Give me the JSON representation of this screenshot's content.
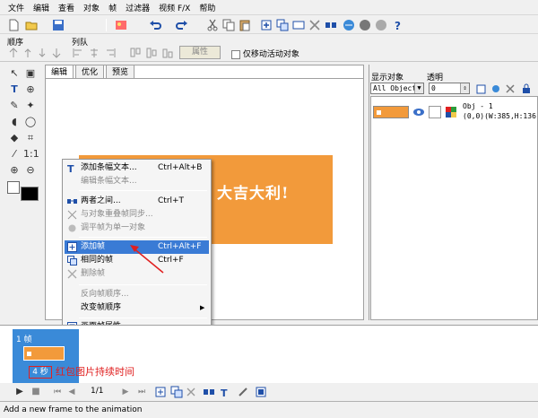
{
  "menu": [
    "文件",
    "编辑",
    "查看",
    "对象",
    "帧",
    "过滤器",
    "视频 F/X",
    "帮助"
  ],
  "toolbar2": {
    "order_label": "顺序",
    "align_label": "列队",
    "props_label": "属性",
    "move_only_label": "仅移动活动对象"
  },
  "tabs": [
    "编辑",
    "优化",
    "预览"
  ],
  "canvas": {
    "banner_text": "计，大吉大利!",
    "banner_color": "#f29a3b"
  },
  "context_menu": {
    "items": [
      {
        "label": "添加条幅文本...",
        "shortcut": "Ctrl+Alt+B",
        "enabled": true,
        "icon": "text-banner-icon"
      },
      {
        "label": "编辑条幅文本...",
        "shortcut": "",
        "enabled": false,
        "icon": ""
      },
      {
        "label": "两者之间...",
        "shortcut": "Ctrl+T",
        "enabled": true,
        "icon": "tween-icon"
      },
      {
        "label": "与对象重叠帧同步...",
        "shortcut": "",
        "enabled": false,
        "icon": "sync-icon"
      },
      {
        "label": "调平帧为单一对象",
        "shortcut": "",
        "enabled": false,
        "icon": "flatten-icon"
      },
      {
        "label": "添加帧",
        "shortcut": "Ctrl+Alt+F",
        "enabled": true,
        "highlighted": true,
        "icon": "add-frame-icon"
      },
      {
        "label": "相同的帧",
        "shortcut": "Ctrl+F",
        "enabled": true,
        "icon": "duplicate-frame-icon"
      },
      {
        "label": "删除帧",
        "shortcut": "",
        "enabled": false,
        "icon": "delete-frame-icon"
      },
      {
        "label": "反向帧顺序...",
        "shortcut": "",
        "enabled": false,
        "icon": ""
      },
      {
        "label": "改变帧顺序",
        "shortcut": "",
        "enabled": true,
        "submenu": true,
        "icon": ""
      },
      {
        "label": "画面帧属性...",
        "shortcut": "",
        "enabled": true,
        "icon": "frame-props-icon"
      }
    ]
  },
  "right_panel": {
    "display_objects_label": "显示对象",
    "transparency_label": "透明",
    "filter_value": "All Object:",
    "transparency_value": "0",
    "object": {
      "name": "Obj - 1",
      "info": "(0,0)(W:385,H:136"
    }
  },
  "timeline": {
    "frame_label": "1 帧",
    "duration_value": "4 秒",
    "annotation": "红包图片持续时间",
    "frame_counter": "1/1"
  },
  "status": "Add a new frame to the animation",
  "colors": {
    "highlight": "#3a7bd5",
    "frame_selected": "#3a8ad8",
    "annotation_red": "#e02020"
  }
}
